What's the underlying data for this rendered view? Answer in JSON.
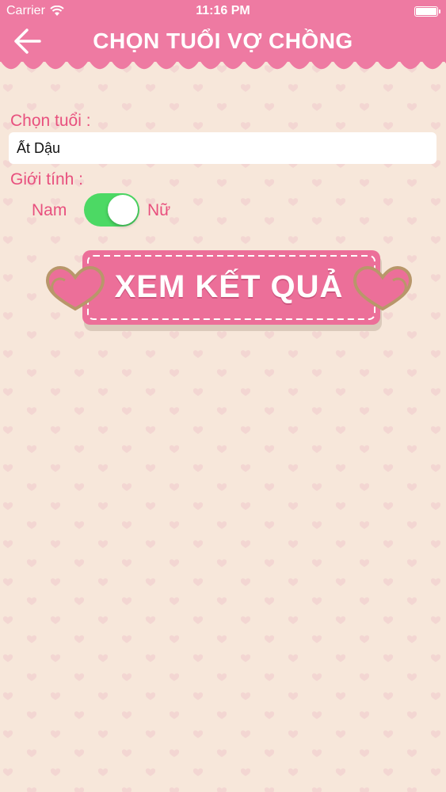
{
  "status_bar": {
    "carrier": "Carrier",
    "time": "11:16 PM"
  },
  "nav": {
    "title": "CHỌN TUỔI VỢ CHỒNG",
    "back_icon": "arrow-left-icon"
  },
  "form": {
    "age_label": "Chọn tuổi :",
    "age_value": "Ất Dậu",
    "gender_label": "Giới tính :",
    "gender_male": "Nam",
    "gender_female": "Nữ",
    "gender_toggle_on": true
  },
  "result_button": {
    "label": "XEM KẾT QUẢ",
    "decor_icon": "double-heart-icon"
  },
  "colors": {
    "accent": "#ee7aa2",
    "label_text": "#e8507e",
    "toggle_on": "#4cd964",
    "background": "#f7e7da",
    "button_fill": "#ec6f99",
    "heart_outline": "#b8976a"
  }
}
